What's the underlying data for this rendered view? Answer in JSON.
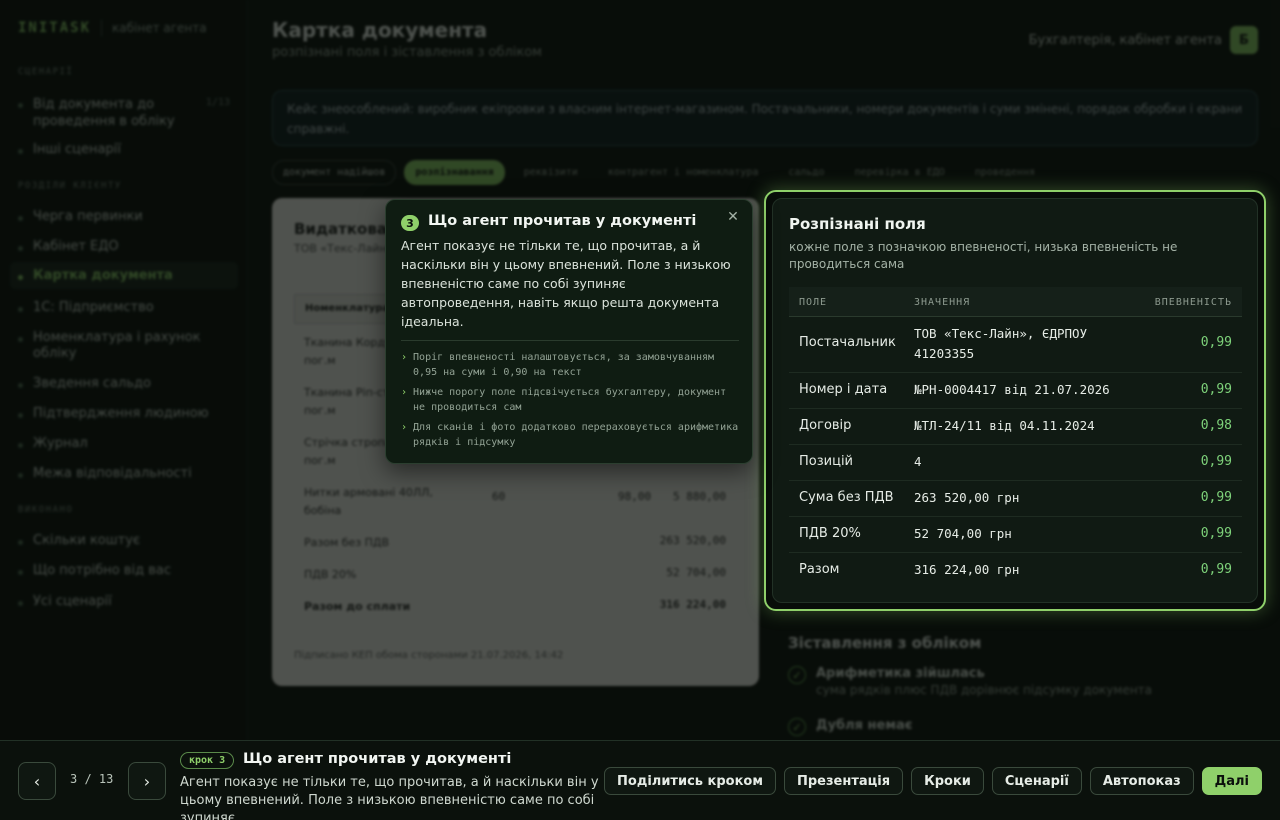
{
  "sidebar": {
    "brand": "INITASK",
    "brand_sub": "кабінет агента",
    "sections": [
      {
        "title": "СЦЕНАРІЇ",
        "items": [
          {
            "label": "Від документа до проведення в обліку",
            "count": "1/13"
          },
          {
            "label": "Інші сценарії"
          }
        ]
      },
      {
        "title": "РОЗДІЛИ КЛІЄНТУ",
        "items": [
          {
            "label": "Черга первинки"
          },
          {
            "label": "Кабінет ЕДО"
          },
          {
            "label": "Картка документа",
            "active": true
          },
          {
            "label": "1С: Підприємство"
          },
          {
            "label": "Номенклатура і рахунок обліку"
          },
          {
            "label": "Зведення сальдо"
          },
          {
            "label": "Підтвердження людиною"
          },
          {
            "label": "Журнал"
          },
          {
            "label": "Межа відповідальності"
          }
        ]
      },
      {
        "title": "ВИКОНАНО",
        "items": [
          {
            "label": "Скільки коштує"
          },
          {
            "label": "Що потрібно від вас"
          },
          {
            "label": "Усі сценарії"
          }
        ]
      }
    ]
  },
  "header": {
    "title": "Картка документа",
    "subtitle": "розпізнані поля і зіставлення з обліком",
    "account": "Бухгалтерія, кабінет агента",
    "avatar": "Б"
  },
  "notice": "Кейс знеособлений: виробник екіпровки з власним інтернет-магазином. Постачальники, номери документів і суми змінені, порядок обробки і екрани справжні.",
  "tabs": [
    {
      "label": "документ надійшов",
      "state": "outline"
    },
    {
      "label": "розпізнавання",
      "state": "active"
    },
    {
      "label": "реквізити",
      "state": "normal"
    },
    {
      "label": "контрагент і номенклатура",
      "state": "normal"
    },
    {
      "label": "сальдо",
      "state": "normal"
    },
    {
      "label": "перевірка в ЕДО",
      "state": "normal"
    },
    {
      "label": "проведення",
      "state": "normal"
    }
  ],
  "document": {
    "title": "Видаткова накладна",
    "subtitle": "ТОВ «Текс-Лайн»",
    "header_col": "Номенклатура",
    "rows": [
      {
        "name": "Тканина Кордура, чорна, пог.м",
        "qty": "",
        "price": "",
        "sum": ""
      },
      {
        "name": "Тканина Рiп-стоп, олива, пог.м",
        "qty": "",
        "price": "",
        "sum": ""
      },
      {
        "name": "Стрічка стропа, койот, пог.м",
        "qty": "",
        "price": "",
        "sum": ""
      },
      {
        "name": "Нитки армовані 40ЛЛ, бобіна",
        "qty": "60",
        "price": "98,00",
        "sum": "5 880,00"
      }
    ],
    "totals": [
      {
        "label": "Разом без ПДВ",
        "value": "263 520,00"
      },
      {
        "label": "ПДВ 20%",
        "value": "52 704,00"
      },
      {
        "label": "Разом до сплати",
        "value": "316 224,00",
        "bold": true
      }
    ],
    "footer": "Підписано КЕП обома сторонами 21.07.2026, 14:42"
  },
  "fields_card": {
    "title": "Розпізнані поля",
    "subtitle": "кожне поле з позначкою впевненості, низька впевненість не проводиться сама",
    "columns": [
      "ПОЛЕ",
      "ЗНАЧЕННЯ",
      "ВПЕВНЕНІСТЬ"
    ],
    "rows": [
      {
        "field": "Постачальник",
        "value": "ТОВ «Текс-Лайн», ЄДРПОУ 41203355",
        "conf": "0,99"
      },
      {
        "field": "Номер і дата",
        "value": "№РН-0004417 від 21.07.2026",
        "conf": "0,99"
      },
      {
        "field": "Договір",
        "value": "№ТЛ-24/11 від 04.11.2024",
        "conf": "0,98"
      },
      {
        "field": "Позицій",
        "value": "4",
        "conf": "0,99"
      },
      {
        "field": "Сума без ПДВ",
        "value": "263 520,00 грн",
        "conf": "0,99"
      },
      {
        "field": "ПДВ 20%",
        "value": "52 704,00 грн",
        "conf": "0,99"
      },
      {
        "field": "Разом",
        "value": "316 224,00 грн",
        "conf": "0,99"
      }
    ]
  },
  "reconciliation": {
    "title": "Зіставлення з обліком",
    "items": [
      {
        "name": "Арифметика зійшлась",
        "desc": "сума рядків плюс ПДВ дорівнює підсумку документа"
      },
      {
        "name": "Дубля немає",
        "desc": ""
      }
    ]
  },
  "popover": {
    "step": "3",
    "title": "Що агент прочитав у документі",
    "body": "Агент показує не тільки те, що прочитав, а й наскільки він у цьому впевнений. Поле з низькою впевненістю саме по собі зупиняє автопроведення, навіть якщо решта документа ідеальна.",
    "notes": [
      "Поріг впевненості налаштовується, за замовчуванням 0,95 на суми і 0,90 на текст",
      "Нижче порогу поле підсвічується бухгалтеру, документ не проводиться сам",
      "Для сканів і фото додатково перераховується арифметика рядків і підсумку"
    ]
  },
  "bottom": {
    "prev": "‹",
    "next": "›",
    "counter": "3 / 13",
    "pill": "крок 3",
    "title": "Що агент прочитав у документі",
    "desc": "Агент показує не тільки те, що прочитав, а й наскільки він у цьому впевнений. Поле з низькою впевненістю саме по собі зупиняє…",
    "actions": [
      "Поділитись кроком",
      "Презентація",
      "Кроки",
      "Сценарії",
      "Автопоказ",
      "Далі"
    ]
  }
}
